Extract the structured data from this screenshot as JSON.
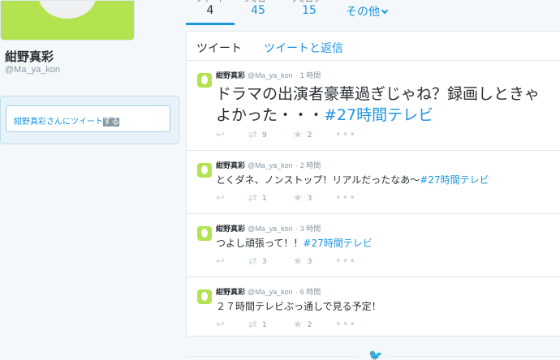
{
  "profile": {
    "name": "紺野真彩",
    "handle": "@Ma_ya_kon"
  },
  "tweetbox": {
    "prompt": "紺野真彩さんにツイート",
    "prompt_selected": "する"
  },
  "stats": {
    "tweets_label": "ツイート",
    "tweets_value": "4",
    "following_label": "フォロー",
    "following_value": "45",
    "followers_label": "フォロワー",
    "followers_value": "15",
    "more_label": "その他"
  },
  "tabs": {
    "tweets": "ツイート",
    "replies": "ツイートと返信"
  },
  "tweets": [
    {
      "name": "紺野真彩",
      "handle": "@Ma_ya_kon",
      "time": "1 時間",
      "text": "ドラマの出演者豪華過ぎじゃね？録画しときゃよかった・・・",
      "hashtag": "#27時間テレビ",
      "retweets": "9",
      "favorites": "2"
    },
    {
      "name": "紺野真彩",
      "handle": "@Ma_ya_kon",
      "time": "2 時間",
      "text": "とくダネ、ノンストップ！リアルだったなあ〜",
      "hashtag": "#27時間テレビ",
      "retweets": "1",
      "favorites": "3"
    },
    {
      "name": "紺野真彩",
      "handle": "@Ma_ya_kon",
      "time": "3 時間",
      "text": "つよし頑張って！！",
      "hashtag": "#27時間テレビ",
      "retweets": "3",
      "favorites": "3"
    },
    {
      "name": "紺野真彩",
      "handle": "@Ma_ya_kon",
      "time": "6 時間",
      "text": "２７時間テレビぶっ通しで見る予定！",
      "hashtag": "",
      "retweets": "1",
      "favorites": "2"
    }
  ],
  "icons": {
    "reply": "reply-icon",
    "retweet": "retweet-icon",
    "favorite": "star-icon",
    "more": "more-icon",
    "bird": "twitter-bird-icon"
  },
  "colors": {
    "accent": "#1b95e0",
    "avatar_bg": "#b4e351",
    "muted": "#8899a6"
  }
}
